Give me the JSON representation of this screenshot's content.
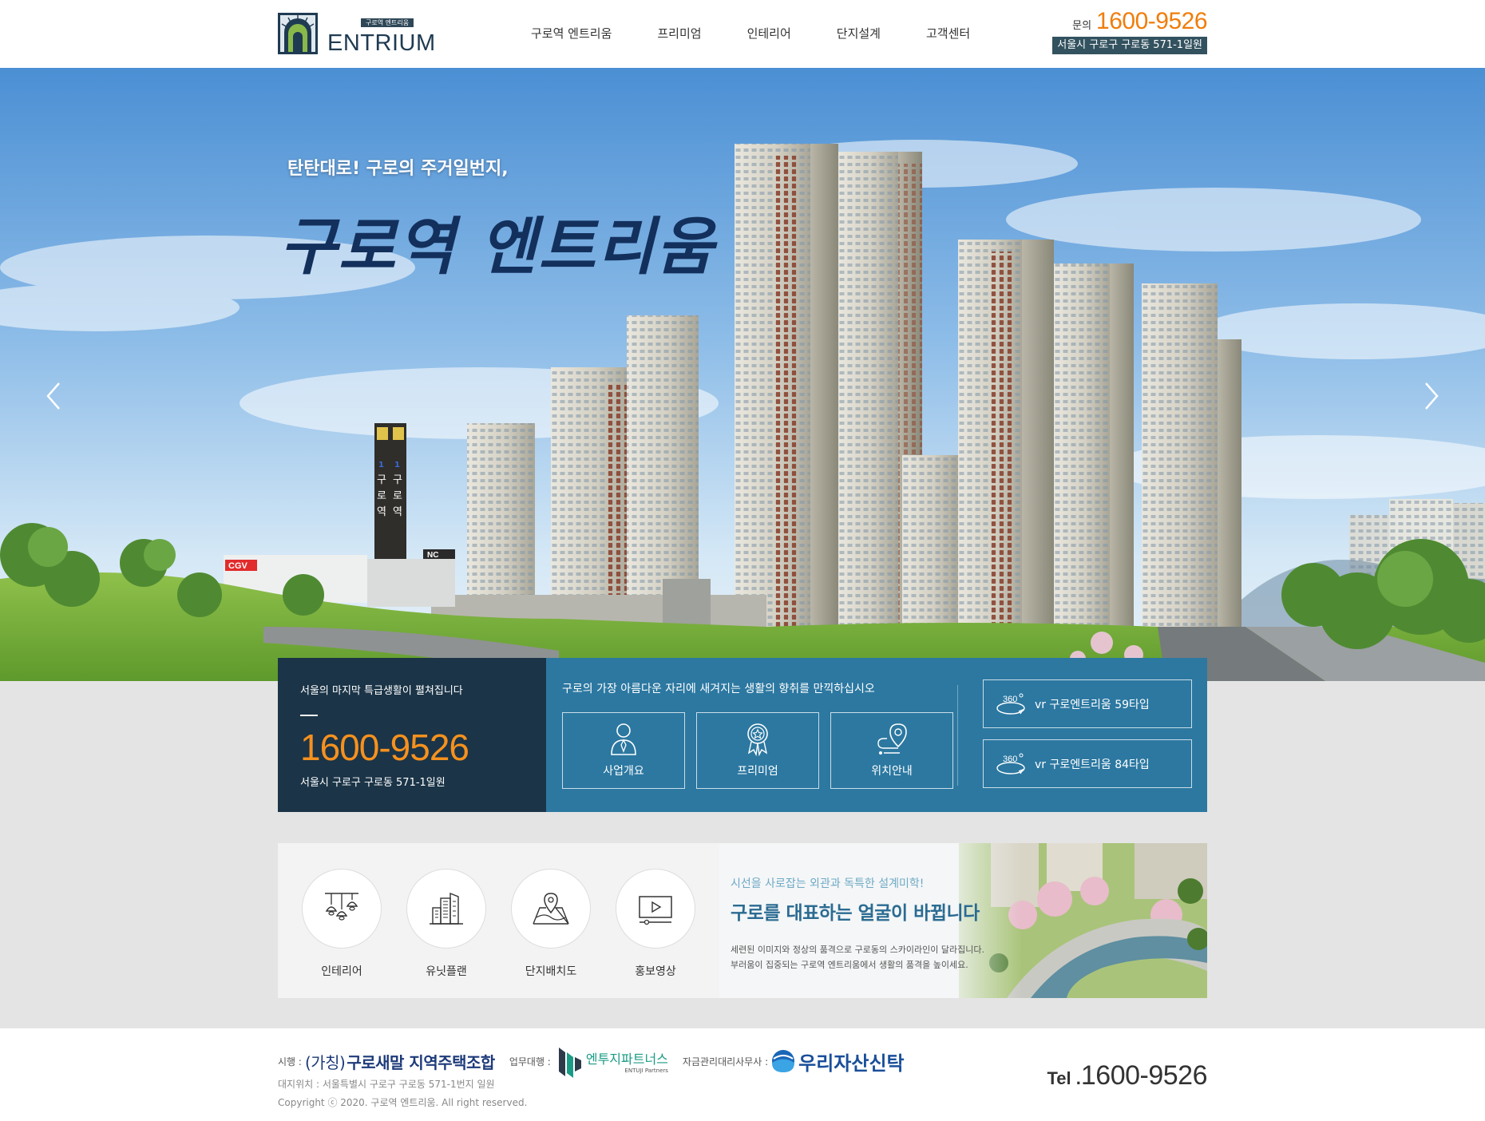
{
  "header": {
    "logo": {
      "badge": "구로역 엔트리움",
      "text": "ENTRIUM"
    },
    "nav": [
      {
        "label": "구로역 엔트리움"
      },
      {
        "label": "프리미엄"
      },
      {
        "label": "인테리어"
      },
      {
        "label": "단지설계"
      },
      {
        "label": "고객센터"
      }
    ],
    "contact": {
      "label": "문의",
      "phone": "1600-9526",
      "address": "서울시 구로구 구로동 571-1일원"
    }
  },
  "hero": {
    "subtitle": "탄탄대로! 구로의 주거일번지,",
    "title": "구로역 엔트리움",
    "station_sign": "1 구로역",
    "signs": [
      "CGV",
      "NC"
    ],
    "prev_icon": "chevron-left-icon",
    "next_icon": "chevron-right-icon"
  },
  "quick": {
    "phone_panel": {
      "intro": "서울의 마지막 특급생활이 펼쳐집니다",
      "phone": "1600-9526",
      "address": "서울시 구로구 구로동 571-1일원"
    },
    "center": {
      "heading": "구로의 가장 아름다운 자리에 새겨지는 생활의 향취를 만끽하십시오",
      "buttons": [
        {
          "label": "사업개요",
          "icon": "person-icon"
        },
        {
          "label": "프리미엄",
          "icon": "medal-icon"
        },
        {
          "label": "위치안내",
          "icon": "location-pin-icon"
        }
      ]
    },
    "vr": [
      {
        "badge": "360",
        "label": "vr 구로엔트리움 59타입",
        "icon": "vr-360-icon"
      },
      {
        "badge": "360",
        "label": "vr 구로엔트리움 84타입",
        "icon": "vr-360-icon"
      }
    ]
  },
  "menu": {
    "items": [
      {
        "label": "인테리어",
        "icon": "pendant-lamp-icon"
      },
      {
        "label": "유닛플랜",
        "icon": "building-icon"
      },
      {
        "label": "단지배치도",
        "icon": "map-icon"
      },
      {
        "label": "홍보영상",
        "icon": "video-play-icon"
      }
    ],
    "promo": {
      "kicker": "시선을 사로잡는 외관과 독특한 설계미학!",
      "title": "구로를 대표하는 얼굴이 바뀝니다",
      "desc_line1": "세련된 이미지와 정상의 품격으로 구로동의 스카이라인이 달라집니다.",
      "desc_line2": "부러움이 집중되는 구로역 엔트리움에서 생활의 품격을 높이세요."
    }
  },
  "footer": {
    "builder_label": "시행 :",
    "builder_prefix": "(가칭)",
    "builder": "구로새말 지역주택조합",
    "agent_label": "업무대행 :",
    "agent": "엔투지파트너스",
    "agent_sub": "ENTUJI Partners",
    "trust_label": "자금관리대리사무사 :",
    "trust": "우리자산신탁",
    "site": "대지위치 : 서울특별시 구로구 구로동 571-1번지 일원",
    "copyright": "Copyright ⓒ 2020. 구로역 엔트리움. All right reserved.",
    "tel_label": "Tel .",
    "tel": "1600-9526"
  },
  "colors": {
    "accent_orange": "#f07d0a",
    "navy": "#1b3447",
    "blue": "#2c78a1",
    "address_bg": "#33525f"
  }
}
